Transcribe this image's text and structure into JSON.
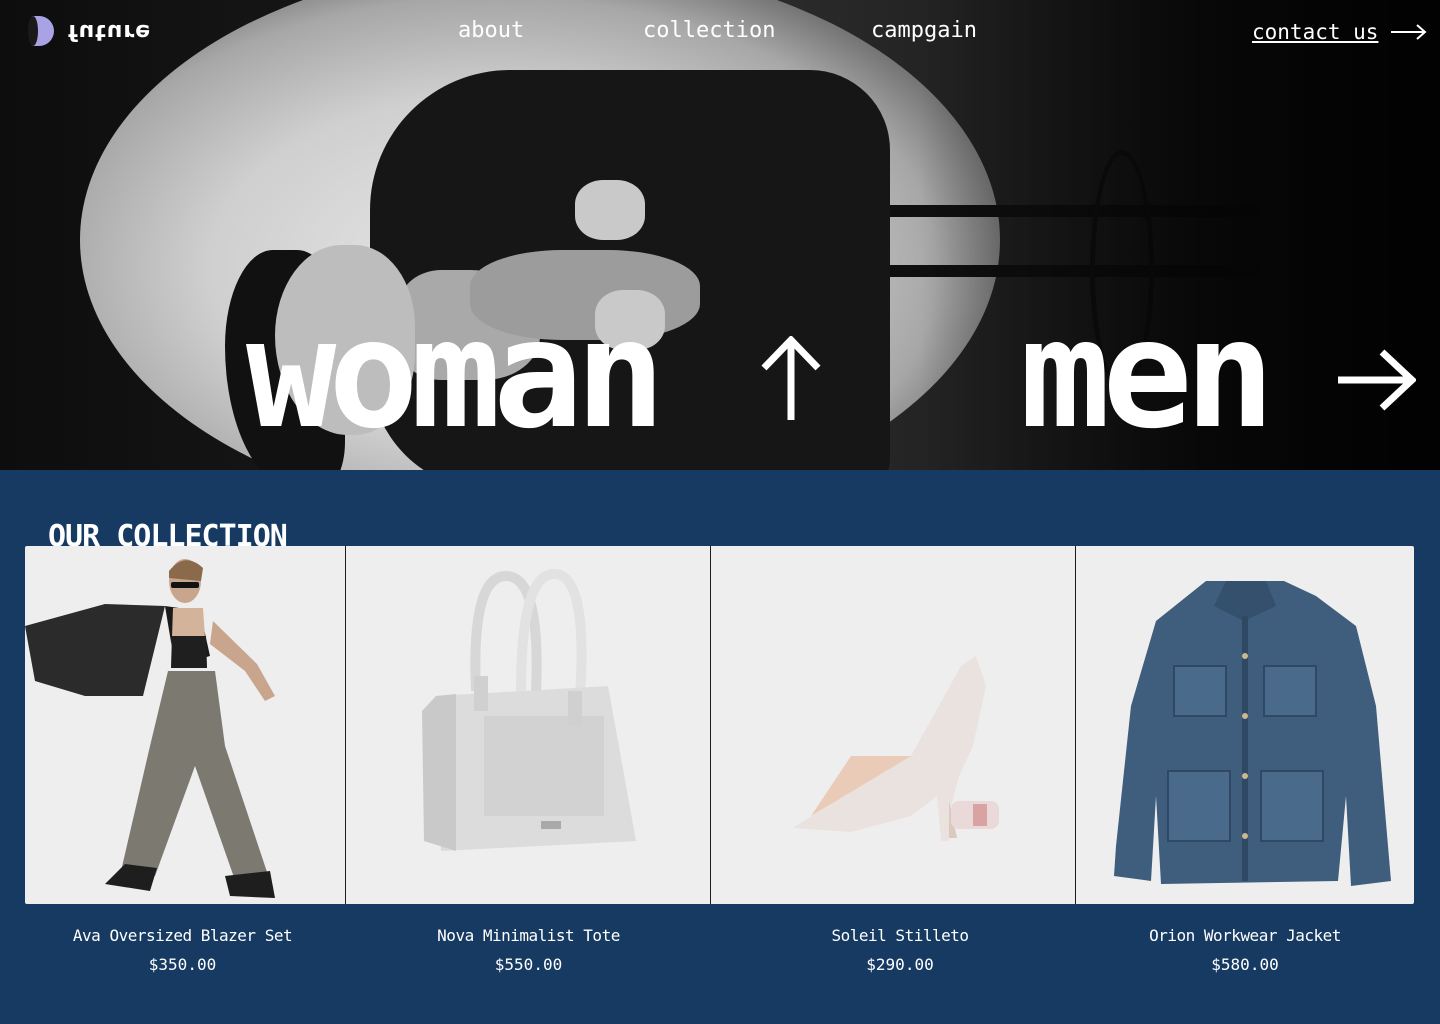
{
  "brand": {
    "logo_text": "future"
  },
  "nav": {
    "about": "about",
    "collection": "collection",
    "campaign": "campgain",
    "contact": "contact us"
  },
  "hero": {
    "woman": "woman",
    "men": "men"
  },
  "collection": {
    "title": "OUR COLLECTION",
    "items": [
      {
        "name": "Ava Oversized Blazer Set",
        "price": "$350.00"
      },
      {
        "name": "Nova Minimalist Tote",
        "price": "$550.00"
      },
      {
        "name": "Soleil Stilleto",
        "price": "$290.00"
      },
      {
        "name": "Orion Workwear Jacket",
        "price": "$580.00"
      }
    ]
  },
  "colors": {
    "hero_bg": "#0d0d0d",
    "section_bg": "#163a62",
    "logo_accent": "#a9a3e6",
    "card_bg": "#eeeeee"
  },
  "icons": [
    "logo-mark-icon",
    "arrow-right-icon",
    "arrow-up-icon"
  ]
}
